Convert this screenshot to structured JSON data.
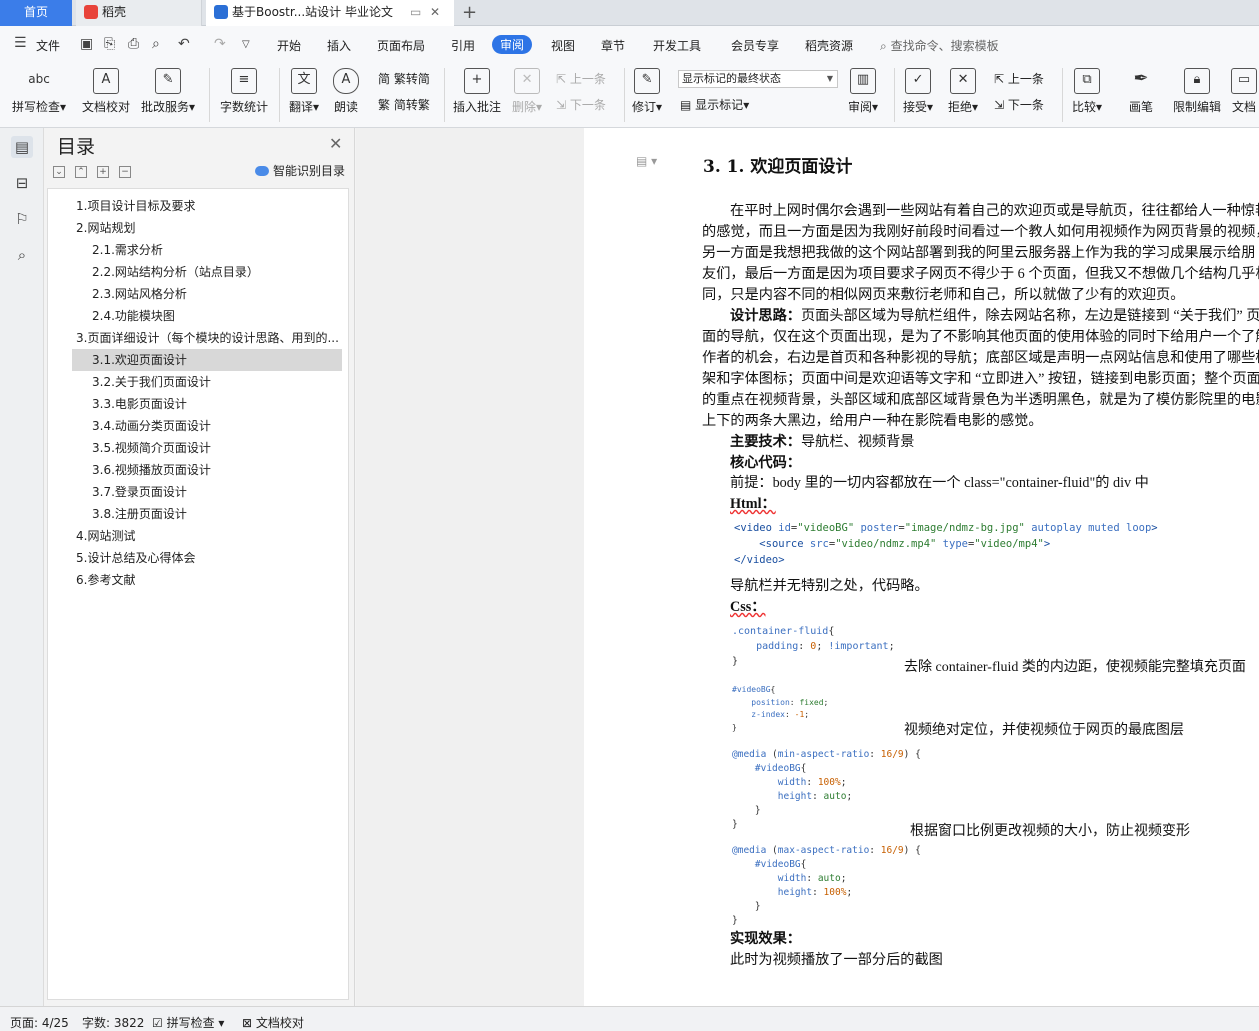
{
  "tabs": {
    "home": "首页",
    "daoke": "稻壳",
    "doc": "基于Boostr...站设计 毕业论文"
  },
  "menu": {
    "file": "文件",
    "items": [
      "开始",
      "插入",
      "页面布局",
      "引用",
      "审阅",
      "视图",
      "章节",
      "开发工具",
      "会员专享",
      "稻壳资源"
    ],
    "active_index": 4,
    "search_placeholder": "查找命令、搜索模板"
  },
  "ribbon": {
    "spell": "拼写检查",
    "doccheck": "文档校对",
    "batch": "批改服务",
    "wordcount": "字数统计",
    "translate": "翻译",
    "read": "朗读",
    "trad": "繁转简",
    "simp": "简转繁",
    "insert_comment": "插入批注",
    "delete": "删除",
    "prev_comment": "上一条",
    "next_comment": "下一条",
    "revise": "修订",
    "markup_select": "显示标记的最终状态",
    "show_markup": "显示标记",
    "review": "审阅",
    "accept": "接受",
    "reject": "拒绝",
    "prev": "上一条",
    "next": "下一条",
    "compare": "比较",
    "pen": "画笔",
    "restrict": "限制编辑",
    "doc_rights": "文档"
  },
  "toc": {
    "title": "目录",
    "smart": "智能识别目录",
    "items": [
      {
        "label": "1.项目设计目标及要求"
      },
      {
        "label": "2.网站规划"
      },
      {
        "label": "2.1.需求分析"
      },
      {
        "label": "2.2.网站结构分析（站点目录）"
      },
      {
        "label": "2.3.网站风格分析"
      },
      {
        "label": "2.4.功能模块图"
      },
      {
        "label": "3.页面详细设计（每个模块的设计思路、用到的..."
      },
      {
        "label": "3.1.欢迎页面设计"
      },
      {
        "label": "3.2.关于我们页面设计"
      },
      {
        "label": "3.3.电影页面设计"
      },
      {
        "label": "3.4.动画分类页面设计"
      },
      {
        "label": "3.5.视频简介页面设计"
      },
      {
        "label": "3.6.视频播放页面设计"
      },
      {
        "label": "3.7.登录页面设计"
      },
      {
        "label": "3.8.注册页面设计"
      },
      {
        "label": "4.网站测试"
      },
      {
        "label": "5.设计总结及心得体会"
      },
      {
        "label": "6.参考文献"
      }
    ],
    "selected_index": 7
  },
  "doc": {
    "heading": "3. 1. 欢迎页面设计",
    "p1": [
      "在平时上网时偶尔会遇到一些网站有着自己的欢迎页或是导航页，往往都给人一种惊艳",
      "的感觉，而且一方面是因为我刚好前段时间看过一个教人如何用视频作为网页背景的视频，",
      "另一方面是我想把我做的这个网站部署到我的阿里云服务器上作为我的学习成果展示给朋",
      "友们，最后一方面是因为项目要求子网页不得少于 6 个页面，但我又不想做几个结构几乎相",
      "同，只是内容不同的相似网页来敷衍老师和自己，所以就做了少有的欢迎页。"
    ],
    "design_label": "设计思路：",
    "p2": [
      "页面头部区域为导航栏组件，除去网站名称，左边是链接到 “关于我们” 页",
      "面的导航，仅在这个页面出现，是为了不影响其他页面的使用体验的同时下给用户一个了解",
      "作者的机会，右边是首页和各种影视的导航；底部区域是声明一点网站信息和使用了哪些框",
      "架和字体图标；页面中间是欢迎语等文字和 “立即进入” 按钮，链接到电影页面；整个页面",
      "的重点在视频背景，头部区域和底部区域背景色为半透明黑色，就是为了模仿影院里的电影",
      "上下的两条大黑边，给用户一种在影院看电影的感觉。"
    ],
    "tech_label": "主要技术：",
    "tech_value": "导航栏、视频背景",
    "core_label": "核心代码：",
    "premise": "前提：body 里的一切内容都放在一个 class=\"container-fluid\"的 div 中",
    "html_label": "Html：",
    "navbar_note": "导航栏并无特别之处，代码略。",
    "css_label": "Css：",
    "note1": "去除 container-fluid 类的内边距，使视频能完整填充页面",
    "note2": "视频绝对定位，并使视频位于网页的最底图层",
    "note3": "根据窗口比例更改视频的大小，防止视频变形",
    "effect_label": "实现效果：",
    "effect_text": "此时为视频播放了一部分后的截图"
  },
  "status": {
    "page": "页面: 4/25",
    "words": "字数: 3822",
    "spell": "拼写检查",
    "doccheck": "文档校对"
  }
}
